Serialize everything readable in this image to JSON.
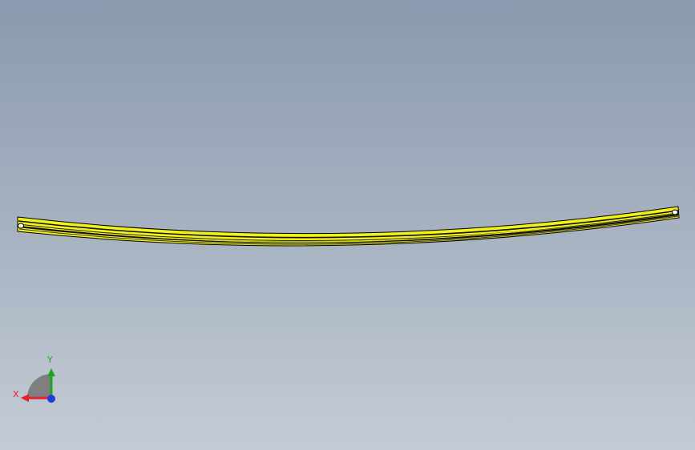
{
  "viewport": {
    "background_top": "#8a9aaf",
    "background_bottom": "#c4cbd4"
  },
  "model": {
    "part": "curved-rail",
    "body_color": "#f2f21a",
    "edge_color": "#000000"
  },
  "triad": {
    "x_label": "X",
    "y_label": "Y",
    "x_color": "#e8202a",
    "y_color": "#1ba81b",
    "z_color": "#1e3ce0"
  }
}
